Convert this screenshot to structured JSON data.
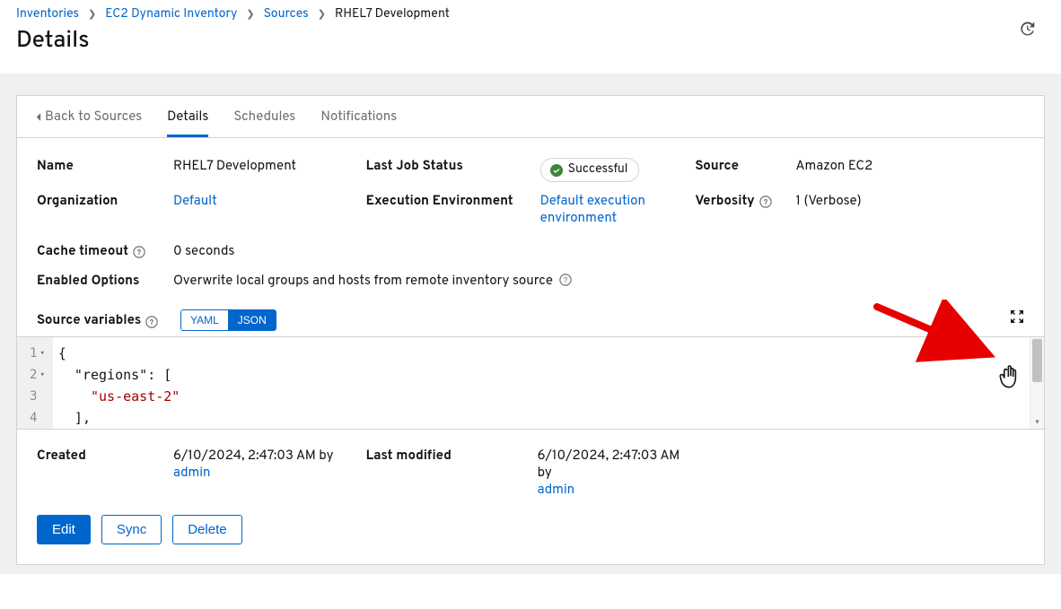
{
  "breadcrumb": {
    "items": [
      "Inventories",
      "EC2 Dynamic Inventory",
      "Sources",
      "RHEL7 Development"
    ]
  },
  "page": {
    "title": "Details"
  },
  "tabs": {
    "back": "Back to Sources",
    "details": "Details",
    "schedules": "Schedules",
    "notifications": "Notifications"
  },
  "details": {
    "name_label": "Name",
    "name_value": "RHEL7 Development",
    "last_job_status_label": "Last Job Status",
    "last_job_status_value": "Successful",
    "source_label": "Source",
    "source_value": "Amazon EC2",
    "organization_label": "Organization",
    "organization_value": "Default",
    "exec_env_label": "Execution Environment",
    "exec_env_value": "Default execution environment",
    "verbosity_label": "Verbosity",
    "verbosity_value": "1 (Verbose)",
    "cache_timeout_label": "Cache timeout",
    "cache_timeout_value": "0 seconds",
    "enabled_options_label": "Enabled Options",
    "enabled_options_value": "Overwrite local groups and hosts from remote inventory source",
    "source_variables_label": "Source variables",
    "toggle_yaml": "YAML",
    "toggle_json": "JSON",
    "created_label": "Created",
    "created_time": "6/10/2024, 2:47:03 AM by",
    "created_user": "admin",
    "modified_label": "Last modified",
    "modified_time": "6/10/2024, 2:47:03 AM by",
    "modified_user": "admin"
  },
  "code": {
    "line1": "{",
    "line2a": "  \"regions\"",
    "line2b": ": [",
    "line3a": "    ",
    "line3b": "\"us-east-2\"",
    "line4": "  ],",
    "ln1": "1",
    "ln2": "2",
    "ln3": "3",
    "ln4": "4"
  },
  "buttons": {
    "edit": "Edit",
    "sync": "Sync",
    "delete": "Delete"
  }
}
